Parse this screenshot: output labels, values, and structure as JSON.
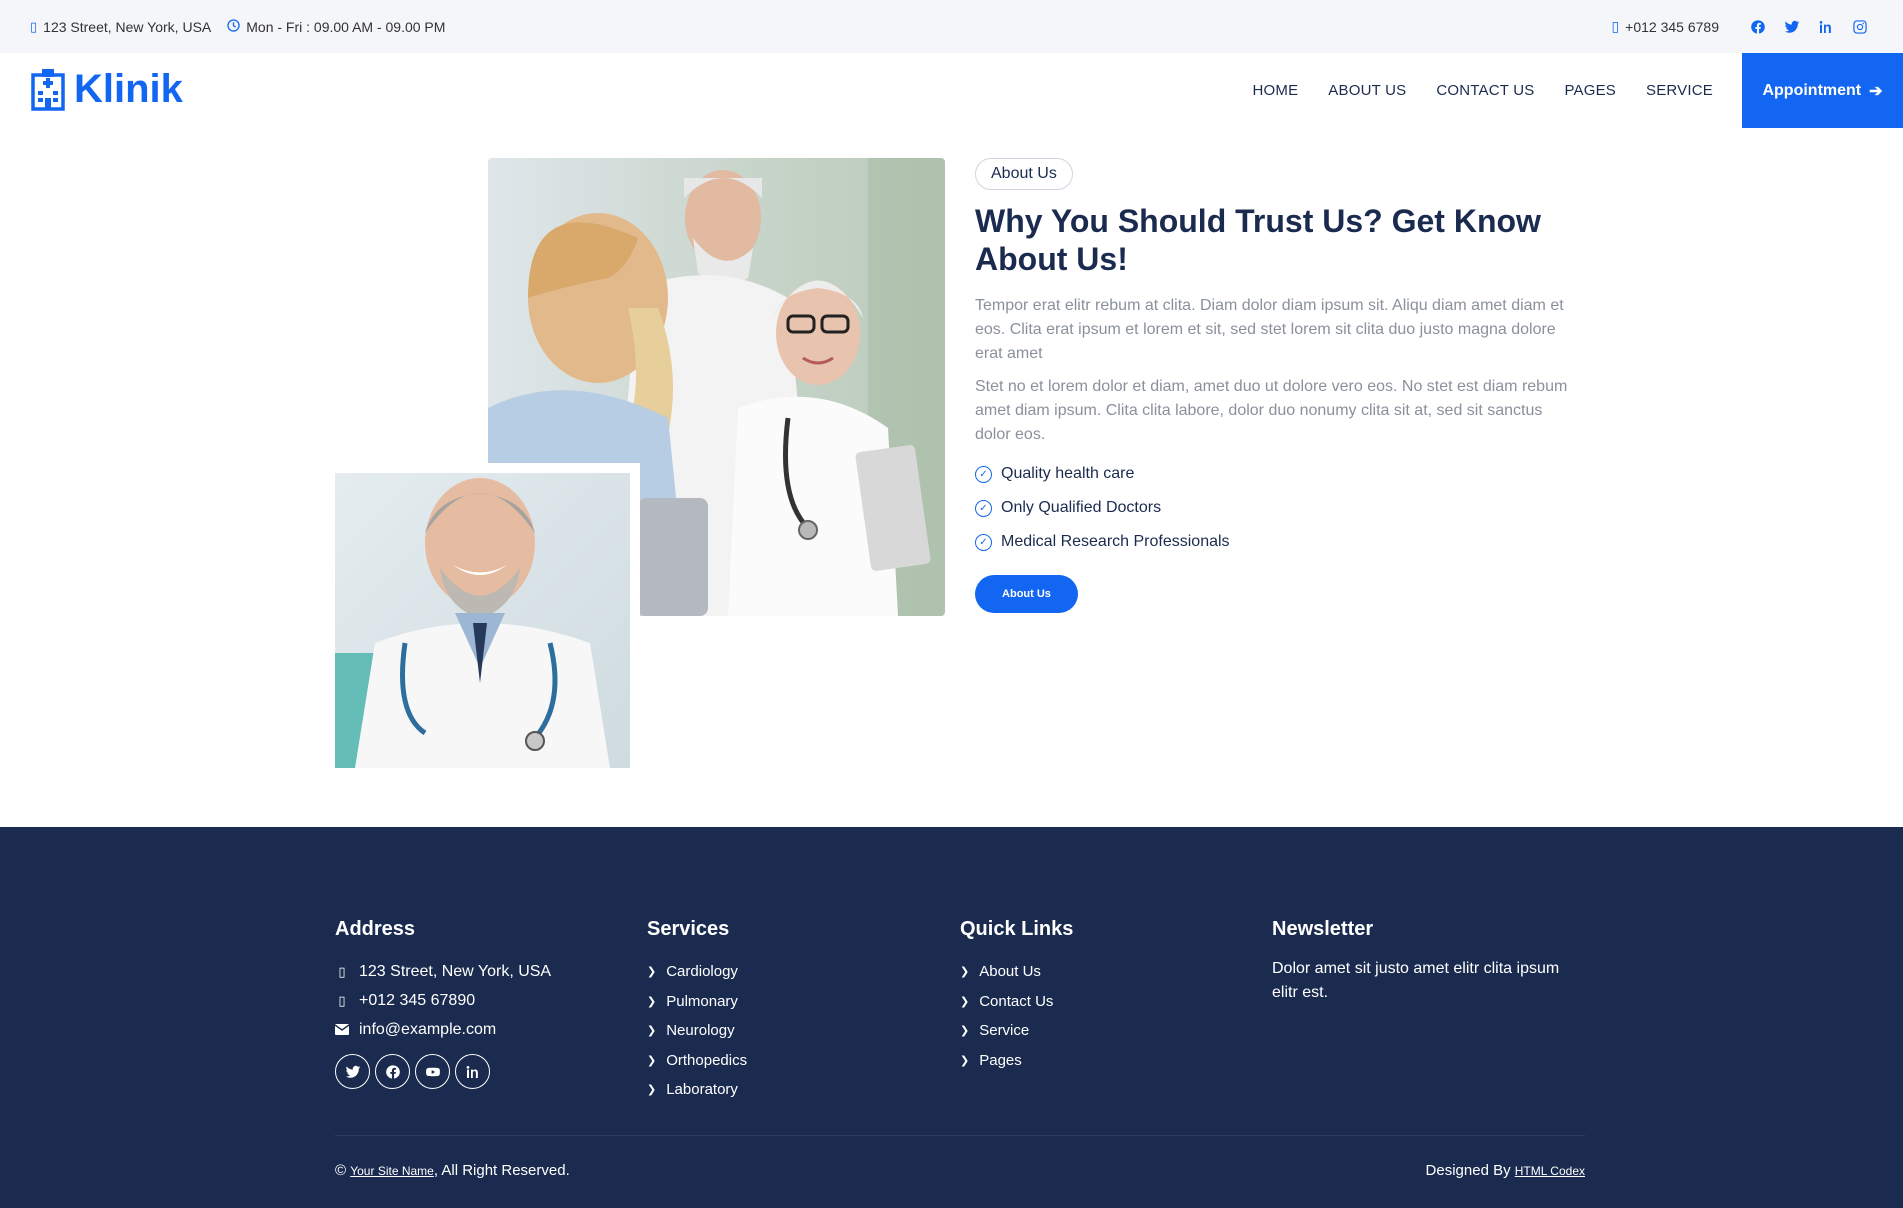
{
  "topbar": {
    "address": "123 Street, New York, USA",
    "hours": "Mon - Fri : 09.00 AM - 09.00 PM",
    "phone": "+012 345 6789",
    "social_icons": [
      "facebook-icon",
      "twitter-icon",
      "linkedin-icon",
      "instagram-icon"
    ]
  },
  "navbar": {
    "brand": "Klinik",
    "links": [
      "HOME",
      "ABOUT US",
      "CONTACT US",
      "PAGES",
      "SERVICE"
    ],
    "appointment": "Appointment"
  },
  "about": {
    "badge": "About Us",
    "title": "Why You Should Trust Us? Get Know About Us!",
    "p1": "Tempor erat elitr rebum at clita. Diam dolor diam ipsum sit. Aliqu diam amet diam et eos. Clita erat ipsum et lorem et sit, sed stet lorem sit clita duo justo magna dolore erat amet",
    "p2": "Stet no et lorem dolor et diam, amet duo ut dolore vero eos. No stet est diam rebum amet diam ipsum. Clita clita labore, dolor duo nonumy clita sit at, sed sit sanctus dolor eos.",
    "checks": [
      "Quality health care",
      "Only Qualified Doctors",
      "Medical Research Professionals"
    ],
    "button": "About Us"
  },
  "footer": {
    "address": {
      "heading": "Address",
      "street": "123 Street, New York, USA",
      "phone": "+012 345 67890",
      "email": "info@example.com"
    },
    "services": {
      "heading": "Services",
      "items": [
        "Cardiology",
        "Pulmonary",
        "Neurology",
        "Orthopedics",
        "Laboratory"
      ]
    },
    "quick_links": {
      "heading": "Quick Links",
      "items": [
        "About Us",
        "Contact Us",
        "Service",
        "Pages"
      ]
    },
    "newsletter": {
      "heading": "Newsletter",
      "text": "Dolor amet sit justo amet elitr clita ipsum elitr est."
    },
    "copyright_symbol": "©",
    "site_name": "Your Site Name",
    "rights": ", All Right Reserved.",
    "designed_by": "Designed By ",
    "designer": "HTML Codex"
  },
  "colors": {
    "primary": "#1266f1",
    "dark": "#1a2b4f",
    "topbar_bg": "#f4f6f9"
  }
}
